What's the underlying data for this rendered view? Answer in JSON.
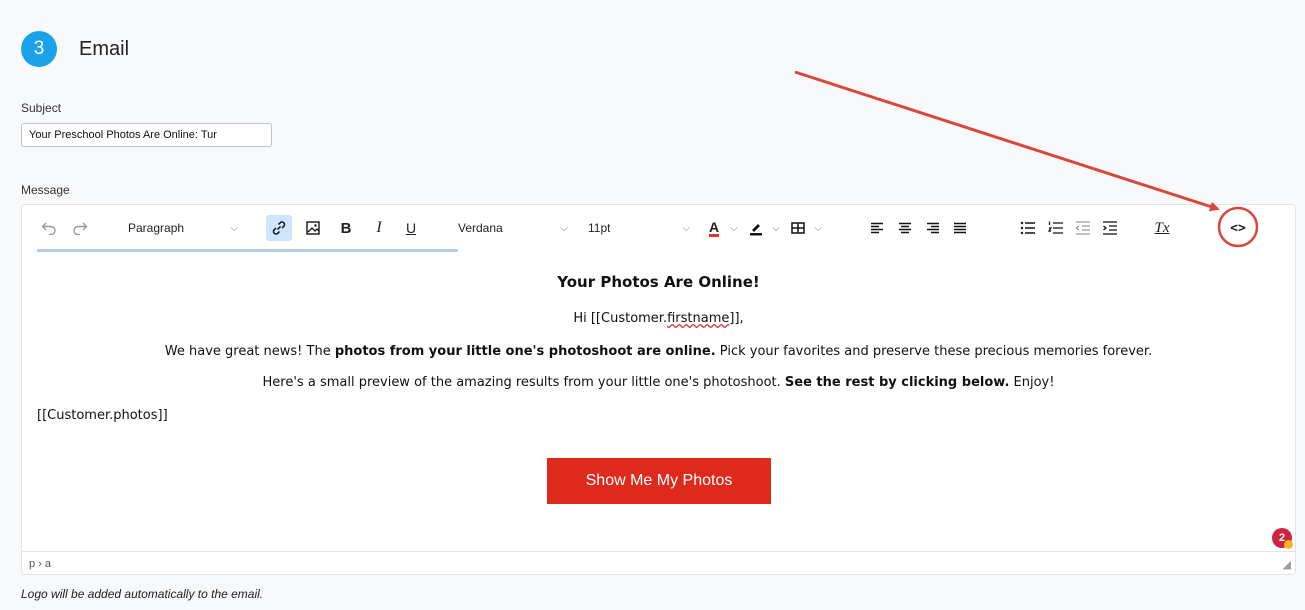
{
  "step": {
    "number": "3",
    "title": "Email"
  },
  "subject": {
    "label": "Subject",
    "value": "Your Preschool Photos Are Online: Tur"
  },
  "message": {
    "label": "Message"
  },
  "toolbar": {
    "block_format": "Paragraph",
    "font_family": "Verdana",
    "font_size": "11pt",
    "icons": [
      "undo-icon",
      "redo-icon",
      "link-icon",
      "image-icon",
      "bold-icon",
      "italic-icon",
      "underline-icon",
      "text-color-icon",
      "highlight-icon",
      "table-icon",
      "align-left-icon",
      "align-center-icon",
      "align-right-icon",
      "justify-icon",
      "bullet-list-icon",
      "numbered-list-icon",
      "outdent-icon",
      "indent-icon",
      "clear-format-icon",
      "source-code-icon"
    ],
    "bold_glyph": "B",
    "italic_glyph": "I",
    "underline_glyph": "U",
    "text_color_glyph": "A",
    "clear_format_glyph": "Tx",
    "source_code_glyph": "<>"
  },
  "body": {
    "heading": "Your Photos Are Online!",
    "greeting_prefix": "Hi [[Customer.",
    "greeting_field": "firstname",
    "greeting_suffix": "]],",
    "para1_a": "We have great news! The ",
    "para1_bold": "photos from your little one's photoshoot are online.",
    "para1_b": " Pick your favorites and preserve these precious memories forever.",
    "para2_a": "Here's a small preview of the amazing results from your little one's photoshoot. ",
    "para2_bold": "See the rest by clicking below.",
    "para2_b": " Enjoy!",
    "photos_placeholder": "[[Customer.photos]]",
    "cta_label": "Show Me My Photos"
  },
  "statusbar": {
    "path": "p › a"
  },
  "notification_count": "2",
  "footer_note": "Logo will be added automatically to the email.",
  "colors": {
    "accent": "#1aa3e8",
    "cta": "#dd2a1d",
    "annotation": "#d9473a"
  }
}
